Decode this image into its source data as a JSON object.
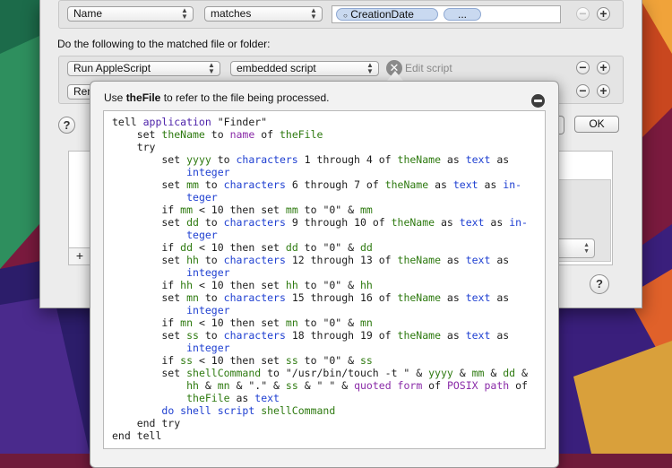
{
  "condition_row": {
    "attribute": "Name",
    "operator": "matches",
    "tokens": [
      "CreationDate",
      "..."
    ]
  },
  "actions_label": "Do the following to the matched file or folder:",
  "action_row1": {
    "action": "Run AppleScript",
    "source": "embedded script",
    "edit_label": "Edit script"
  },
  "action_row2": {
    "action_partial": "Ren"
  },
  "ok_label": "OK",
  "help_glyph": "?",
  "add_glyph": "+",
  "remove_glyph": "−",
  "popover": {
    "hint_prefix": "Use ",
    "hint_bold": "theFile",
    "hint_suffix": " to refer to the file being processed.",
    "code_lines": [
      [
        [
          "k",
          "tell "
        ],
        [
          "a",
          "application"
        ],
        [
          "k",
          " \"Finder\""
        ]
      ],
      [
        [
          "k",
          "    set "
        ],
        [
          "v",
          "theName"
        ],
        [
          "k",
          " to "
        ],
        [
          "p",
          "name"
        ],
        [
          "k",
          " of "
        ],
        [
          "v",
          "theFile"
        ]
      ],
      [
        [
          "k",
          "    try"
        ]
      ],
      [
        [
          "k",
          "        set "
        ],
        [
          "v",
          "yyyy"
        ],
        [
          "k",
          " to "
        ],
        [
          "c",
          "characters"
        ],
        [
          "k",
          " 1 through 4 of "
        ],
        [
          "v",
          "theName"
        ],
        [
          "k",
          " as "
        ],
        [
          "c",
          "text"
        ],
        [
          "k",
          " as"
        ]
      ],
      [
        [
          "k",
          "            "
        ],
        [
          "c",
          "integer"
        ]
      ],
      [
        [
          "k",
          "        set "
        ],
        [
          "v",
          "mm"
        ],
        [
          "k",
          " to "
        ],
        [
          "c",
          "characters"
        ],
        [
          "k",
          " 6 through 7 of "
        ],
        [
          "v",
          "theName"
        ],
        [
          "k",
          " as "
        ],
        [
          "c",
          "text"
        ],
        [
          "k",
          " as "
        ],
        [
          "c",
          "in-"
        ]
      ],
      [
        [
          "k",
          "            "
        ],
        [
          "c",
          "teger"
        ]
      ],
      [
        [
          "k",
          "        if "
        ],
        [
          "v",
          "mm"
        ],
        [
          "k",
          " < 10 then set "
        ],
        [
          "v",
          "mm"
        ],
        [
          "k",
          " to \"0\" & "
        ],
        [
          "v",
          "mm"
        ]
      ],
      [
        [
          "k",
          "        set "
        ],
        [
          "v",
          "dd"
        ],
        [
          "k",
          " to "
        ],
        [
          "c",
          "characters"
        ],
        [
          "k",
          " 9 through 10 of "
        ],
        [
          "v",
          "theName"
        ],
        [
          "k",
          " as "
        ],
        [
          "c",
          "text"
        ],
        [
          "k",
          " as "
        ],
        [
          "c",
          "in-"
        ]
      ],
      [
        [
          "k",
          "            "
        ],
        [
          "c",
          "teger"
        ]
      ],
      [
        [
          "k",
          "        if "
        ],
        [
          "v",
          "dd"
        ],
        [
          "k",
          " < 10 then set "
        ],
        [
          "v",
          "dd"
        ],
        [
          "k",
          " to \"0\" & "
        ],
        [
          "v",
          "dd"
        ]
      ],
      [
        [
          "k",
          "        set "
        ],
        [
          "v",
          "hh"
        ],
        [
          "k",
          " to "
        ],
        [
          "c",
          "characters"
        ],
        [
          "k",
          " 12 through 13 of "
        ],
        [
          "v",
          "theName"
        ],
        [
          "k",
          " as "
        ],
        [
          "c",
          "text"
        ],
        [
          "k",
          " as"
        ]
      ],
      [
        [
          "k",
          "            "
        ],
        [
          "c",
          "integer"
        ]
      ],
      [
        [
          "k",
          "        if "
        ],
        [
          "v",
          "hh"
        ],
        [
          "k",
          " < 10 then set "
        ],
        [
          "v",
          "hh"
        ],
        [
          "k",
          " to \"0\" & "
        ],
        [
          "v",
          "hh"
        ]
      ],
      [
        [
          "k",
          "        set "
        ],
        [
          "v",
          "mn"
        ],
        [
          "k",
          " to "
        ],
        [
          "c",
          "characters"
        ],
        [
          "k",
          " 15 through 16 of "
        ],
        [
          "v",
          "theName"
        ],
        [
          "k",
          " as "
        ],
        [
          "c",
          "text"
        ],
        [
          "k",
          " as"
        ]
      ],
      [
        [
          "k",
          "            "
        ],
        [
          "c",
          "integer"
        ]
      ],
      [
        [
          "k",
          "        if "
        ],
        [
          "v",
          "mn"
        ],
        [
          "k",
          " < 10 then set "
        ],
        [
          "v",
          "mn"
        ],
        [
          "k",
          " to \"0\" & "
        ],
        [
          "v",
          "mn"
        ]
      ],
      [
        [
          "k",
          "        set "
        ],
        [
          "v",
          "ss"
        ],
        [
          "k",
          " to "
        ],
        [
          "c",
          "characters"
        ],
        [
          "k",
          " 18 through 19 of "
        ],
        [
          "v",
          "theName"
        ],
        [
          "k",
          " as "
        ],
        [
          "c",
          "text"
        ],
        [
          "k",
          " as"
        ]
      ],
      [
        [
          "k",
          "            "
        ],
        [
          "c",
          "integer"
        ]
      ],
      [
        [
          "k",
          "        if "
        ],
        [
          "v",
          "ss"
        ],
        [
          "k",
          " < 10 then set "
        ],
        [
          "v",
          "ss"
        ],
        [
          "k",
          " to \"0\" & "
        ],
        [
          "v",
          "ss"
        ]
      ],
      [
        [
          "k",
          "        set "
        ],
        [
          "v",
          "shellCommand"
        ],
        [
          "k",
          " to \"/usr/bin/touch -t \" & "
        ],
        [
          "v",
          "yyyy"
        ],
        [
          "k",
          " & "
        ],
        [
          "v",
          "mm"
        ],
        [
          "k",
          " & "
        ],
        [
          "v",
          "dd"
        ],
        [
          "k",
          " &"
        ]
      ],
      [
        [
          "k",
          "            "
        ],
        [
          "v",
          "hh"
        ],
        [
          "k",
          " & "
        ],
        [
          "v",
          "mn"
        ],
        [
          "k",
          " & \".\" & "
        ],
        [
          "v",
          "ss"
        ],
        [
          "k",
          " & \" \" & "
        ],
        [
          "p",
          "quoted form"
        ],
        [
          "k",
          " of "
        ],
        [
          "p",
          "POSIX path"
        ],
        [
          "k",
          " of"
        ]
      ],
      [
        [
          "k",
          "            "
        ],
        [
          "v",
          "theFile"
        ],
        [
          "k",
          " as "
        ],
        [
          "c",
          "text"
        ]
      ],
      [
        [
          "k",
          "        "
        ],
        [
          "c",
          "do shell script"
        ],
        [
          "k",
          " "
        ],
        [
          "v",
          "shellCommand"
        ]
      ],
      [
        [
          "k",
          "    end try"
        ]
      ],
      [
        [
          "k",
          "end tell"
        ]
      ]
    ]
  }
}
